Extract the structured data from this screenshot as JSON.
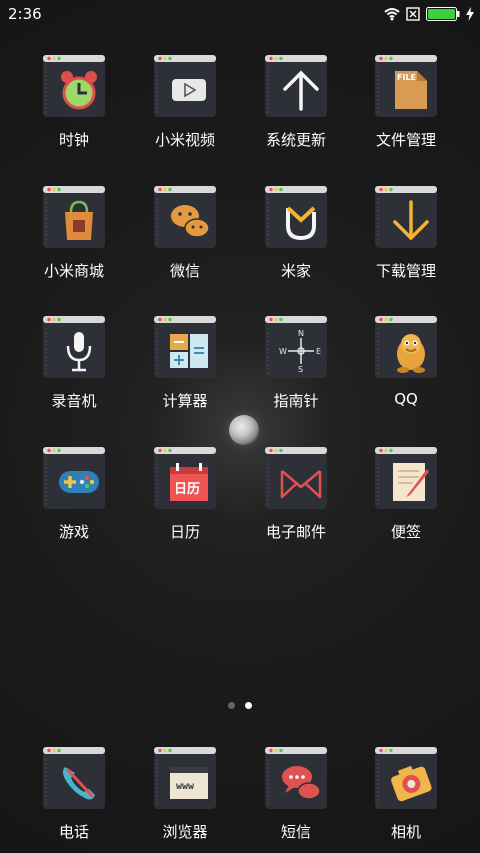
{
  "status_bar": {
    "time": "2:36",
    "icons": [
      "wifi-icon",
      "no-sim-icon",
      "battery-icon",
      "charging-icon"
    ],
    "battery_color": "#3ecf3e"
  },
  "colors": {
    "window_frame": "#2e3038",
    "window_titlebar": "#d9d9d9",
    "dot_red": "#ef4f4f",
    "dot_yellow": "#f2c744",
    "dot_green": "#4fc94f"
  },
  "home_screen": {
    "apps": [
      {
        "label": "时钟",
        "icon": "alarm-clock-icon"
      },
      {
        "label": "小米视频",
        "icon": "video-player-icon"
      },
      {
        "label": "系统更新",
        "icon": "arrow-up-icon"
      },
      {
        "label": "文件管理",
        "icon": "file-icon"
      },
      {
        "label": "小米商城",
        "icon": "shopping-bag-icon"
      },
      {
        "label": "微信",
        "icon": "wechat-icon"
      },
      {
        "label": "米家",
        "icon": "mijia-icon"
      },
      {
        "label": "下载管理",
        "icon": "arrow-down-icon"
      },
      {
        "label": "录音机",
        "icon": "microphone-icon"
      },
      {
        "label": "计算器",
        "icon": "calculator-icon"
      },
      {
        "label": "指南针",
        "icon": "compass-icon"
      },
      {
        "label": "QQ",
        "icon": "qq-penguin-icon"
      },
      {
        "label": "游戏",
        "icon": "gamepad-icon"
      },
      {
        "label": "日历",
        "icon": "calendar-icon"
      },
      {
        "label": "电子邮件",
        "icon": "envelope-icon"
      },
      {
        "label": "便签",
        "icon": "notepad-icon"
      }
    ],
    "page_indicator": {
      "pages": 2,
      "current": 2
    }
  },
  "icon_text": {
    "file": "FILE",
    "calendar": "日历",
    "compass_n": "N",
    "compass_s": "S",
    "compass_w": "W",
    "compass_e": "E",
    "browser": "www"
  },
  "dock": {
    "apps": [
      {
        "label": "电话",
        "icon": "phone-icon"
      },
      {
        "label": "浏览器",
        "icon": "browser-icon"
      },
      {
        "label": "短信",
        "icon": "message-bubble-icon"
      },
      {
        "label": "相机",
        "icon": "camera-icon"
      }
    ]
  }
}
